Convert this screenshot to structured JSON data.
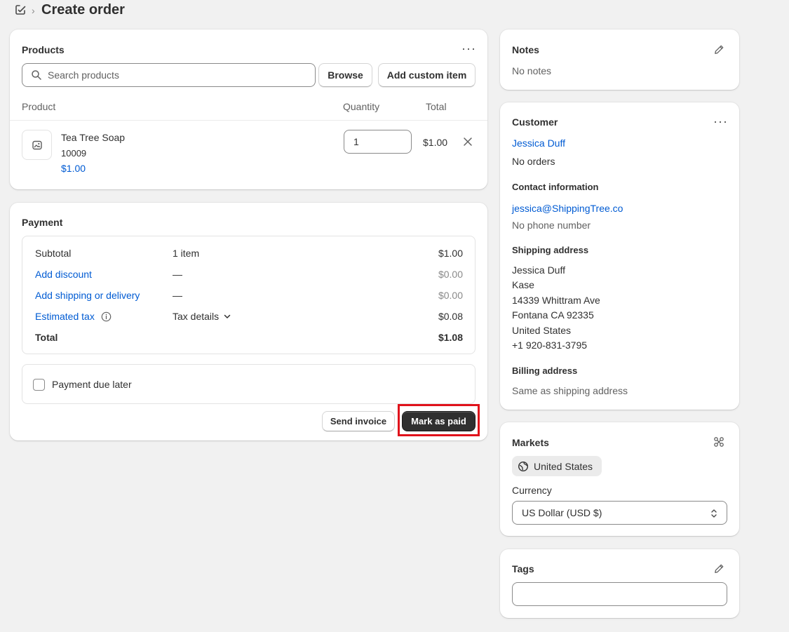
{
  "header": {
    "title": "Create order"
  },
  "products": {
    "title": "Products",
    "search_placeholder": "Search products",
    "browse_label": "Browse",
    "add_custom_label": "Add custom item",
    "columns": {
      "product": "Product",
      "quantity": "Quantity",
      "total": "Total"
    },
    "item": {
      "name": "Tea Tree Soap",
      "sku": "10009",
      "price": "$1.00",
      "quantity": "1",
      "total": "$1.00"
    }
  },
  "payment": {
    "title": "Payment",
    "rows": [
      {
        "label": "Subtotal",
        "middle": "1 item",
        "amount": "$1.00"
      },
      {
        "label": "Add discount",
        "middle": "—",
        "amount": "$0.00"
      },
      {
        "label": "Add shipping or delivery",
        "middle": "—",
        "amount": "$0.00"
      },
      {
        "label": "Estimated tax",
        "middle": "Tax details",
        "amount": "$0.08"
      },
      {
        "label": "Total",
        "middle": "",
        "amount": "$1.08"
      }
    ],
    "due_later_label": "Payment due later",
    "send_invoice_label": "Send invoice",
    "mark_paid_label": "Mark as paid"
  },
  "notes": {
    "title": "Notes",
    "body": "No notes"
  },
  "customer": {
    "title": "Customer",
    "name": "Jessica Duff",
    "orders": "No orders",
    "contact_title": "Contact information",
    "email": "jessica@ShippingTree.co",
    "phone": "No phone number",
    "shipping_title": "Shipping address",
    "shipping_lines": [
      "Jessica Duff",
      "Kase",
      "14339 Whittram Ave",
      "Fontana CA 92335",
      "United States",
      "+1 920-831-3795"
    ],
    "billing_title": "Billing address",
    "billing_body": "Same as shipping address"
  },
  "markets": {
    "title": "Markets",
    "market": "United States",
    "currency_label": "Currency",
    "currency_value": "US Dollar (USD $)"
  },
  "tags": {
    "title": "Tags",
    "value": ""
  },
  "colors": {
    "link": "#005bd3",
    "primary_button": "#303030",
    "highlight": "#e0121b",
    "page_bg": "#f1f1f1"
  }
}
